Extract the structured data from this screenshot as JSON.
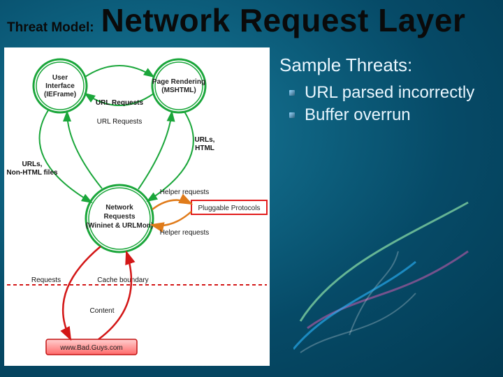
{
  "title": {
    "prefix_small": "Threat Model:",
    "main": "Network Request Layer"
  },
  "threats": {
    "heading": "Sample Threats:",
    "items": [
      "URL parsed incorrectly",
      "Buffer overrun"
    ]
  },
  "diagram": {
    "nodes": {
      "ui": {
        "label_lines": [
          "User",
          "Interface",
          "(IEFrame)"
        ]
      },
      "render": {
        "label_lines": [
          "Page Rendering",
          "(MSHTML)"
        ]
      },
      "network": {
        "label_lines": [
          "Network",
          "Requests",
          "(Wininet & URLMon)"
        ]
      },
      "pluggable": {
        "label": "Pluggable Protocols"
      },
      "badguys": {
        "label": "www.Bad.Guys.com"
      }
    },
    "edges": {
      "ui_render_top": "URL Requests",
      "ui_render_bot": "URL Requests",
      "ui_network": "URLs,\nNon-HTML files",
      "render_network": "URLs,\nHTML",
      "net_plug_top": "Helper requests",
      "net_plug_bot": "Helper requests",
      "cache_boundary": "Cache boundary",
      "requests_out": "Requests",
      "content_in": "Content"
    }
  }
}
